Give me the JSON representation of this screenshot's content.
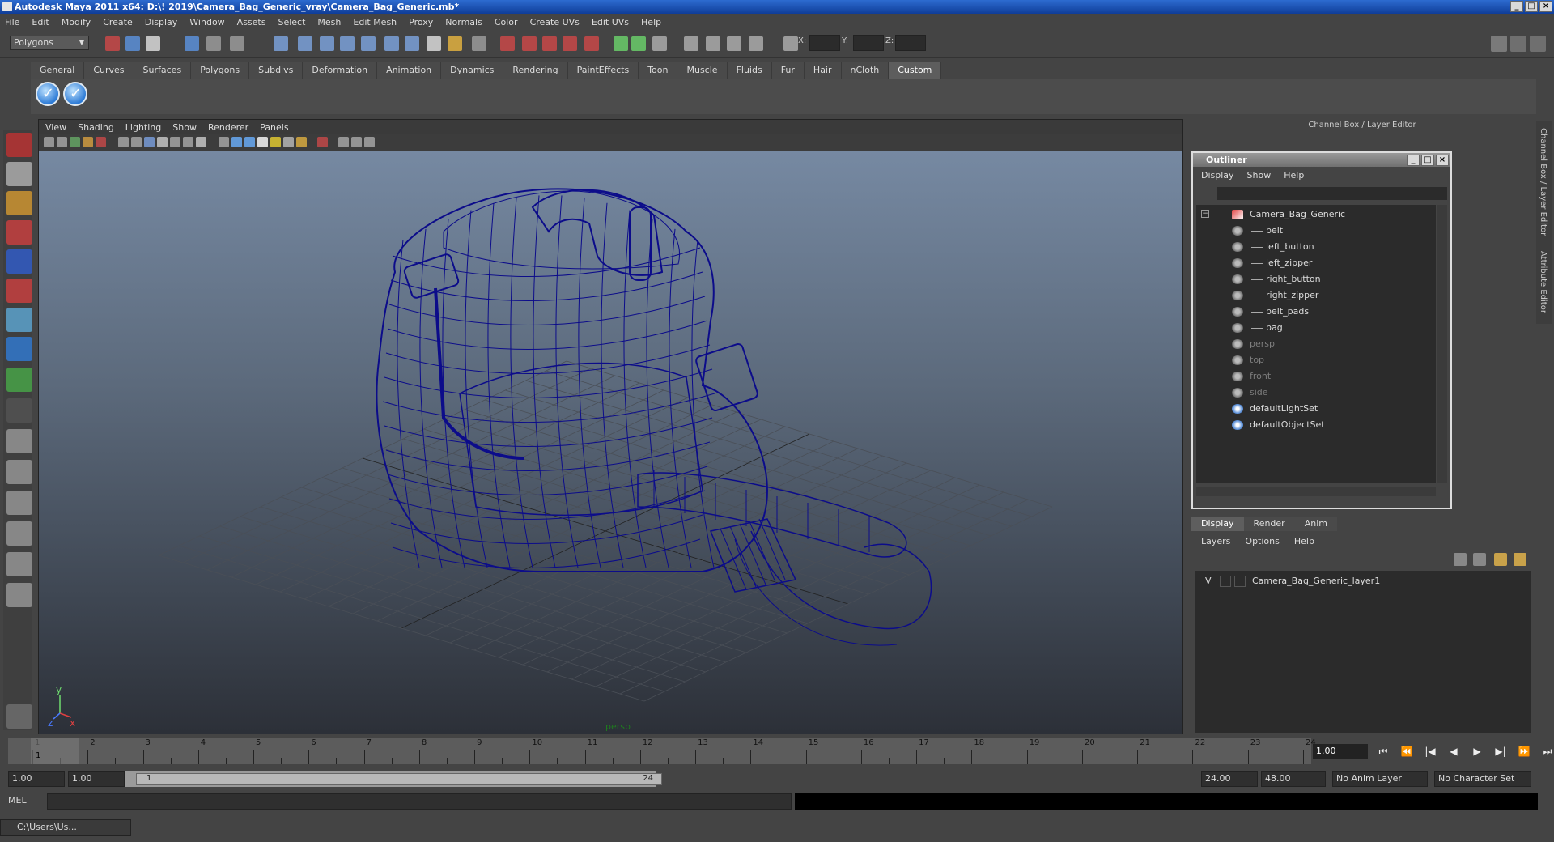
{
  "window": {
    "title": "Autodesk Maya 2011 x64: D:\\! 2019\\Camera_Bag_Generic_vray\\Camera_Bag_Generic.mb*"
  },
  "menubar": [
    "File",
    "Edit",
    "Modify",
    "Create",
    "Display",
    "Window",
    "Assets",
    "Select",
    "Mesh",
    "Edit Mesh",
    "Proxy",
    "Normals",
    "Color",
    "Create UVs",
    "Edit UVs",
    "Help"
  ],
  "statusline": {
    "mode": "Polygons",
    "x_label": "X:",
    "y_label": "Y:",
    "z_label": "Z:"
  },
  "shelf": {
    "tabs": [
      "General",
      "Curves",
      "Surfaces",
      "Polygons",
      "Subdivs",
      "Deformation",
      "Animation",
      "Dynamics",
      "Rendering",
      "PaintEffects",
      "Toon",
      "Muscle",
      "Fluids",
      "Fur",
      "Hair",
      "nCloth",
      "Custom"
    ],
    "active": "Custom"
  },
  "viewport": {
    "menu": [
      "View",
      "Shading",
      "Lighting",
      "Show",
      "Renderer",
      "Panels"
    ],
    "camera": "persp",
    "axis_y": "y",
    "axis_x": "x",
    "axis_z": "z",
    "wire_color": "#0c0c8a"
  },
  "channelbox": {
    "title": "Channel Box / Layer Editor",
    "side_tabs": [
      "Channel Box / Layer Editor",
      "Attribute Editor"
    ]
  },
  "outliner": {
    "title": "Outliner",
    "menu": [
      "Display",
      "Show",
      "Help"
    ],
    "items": [
      {
        "label": "Camera_Bag_Generic",
        "indent": 0,
        "dim": false,
        "icon": "group-icon"
      },
      {
        "label": "belt",
        "indent": 1,
        "dim": false,
        "icon": "mesh-icon"
      },
      {
        "label": "left_button",
        "indent": 1,
        "dim": false,
        "icon": "mesh-icon"
      },
      {
        "label": "left_zipper",
        "indent": 1,
        "dim": false,
        "icon": "mesh-icon"
      },
      {
        "label": "right_button",
        "indent": 1,
        "dim": false,
        "icon": "mesh-icon"
      },
      {
        "label": "right_zipper",
        "indent": 1,
        "dim": false,
        "icon": "mesh-icon"
      },
      {
        "label": "belt_pads",
        "indent": 1,
        "dim": false,
        "icon": "mesh-icon"
      },
      {
        "label": "bag",
        "indent": 1,
        "dim": false,
        "icon": "mesh-icon"
      },
      {
        "label": "persp",
        "indent": 0,
        "dim": true,
        "icon": "camera-icon"
      },
      {
        "label": "top",
        "indent": 0,
        "dim": true,
        "icon": "camera-icon"
      },
      {
        "label": "front",
        "indent": 0,
        "dim": true,
        "icon": "camera-icon"
      },
      {
        "label": "side",
        "indent": 0,
        "dim": true,
        "icon": "camera-icon"
      },
      {
        "label": "defaultLightSet",
        "indent": 0,
        "dim": false,
        "icon": "set-icon"
      },
      {
        "label": "defaultObjectSet",
        "indent": 0,
        "dim": false,
        "icon": "set-icon"
      }
    ]
  },
  "layers": {
    "tabs": [
      "Display",
      "Render",
      "Anim"
    ],
    "active": "Display",
    "menu": [
      "Layers",
      "Options",
      "Help"
    ],
    "rows": [
      {
        "visible": "V",
        "name": "Camera_Bag_Generic_layer1"
      }
    ]
  },
  "timeline": {
    "start": 1,
    "end": 24,
    "current_frame": "1.00",
    "first_tick_label": "1"
  },
  "range": {
    "start": "1.00",
    "playback_start": "1.00",
    "slider_start": "1",
    "slider_end": "24",
    "playback_end": "24.00",
    "end": "48.00",
    "anim_layer": "No Anim Layer",
    "character_set": "No Character Set"
  },
  "cmdline": {
    "label": "MEL"
  },
  "taskbar": {
    "label": "C:\\Users\\Us..."
  }
}
